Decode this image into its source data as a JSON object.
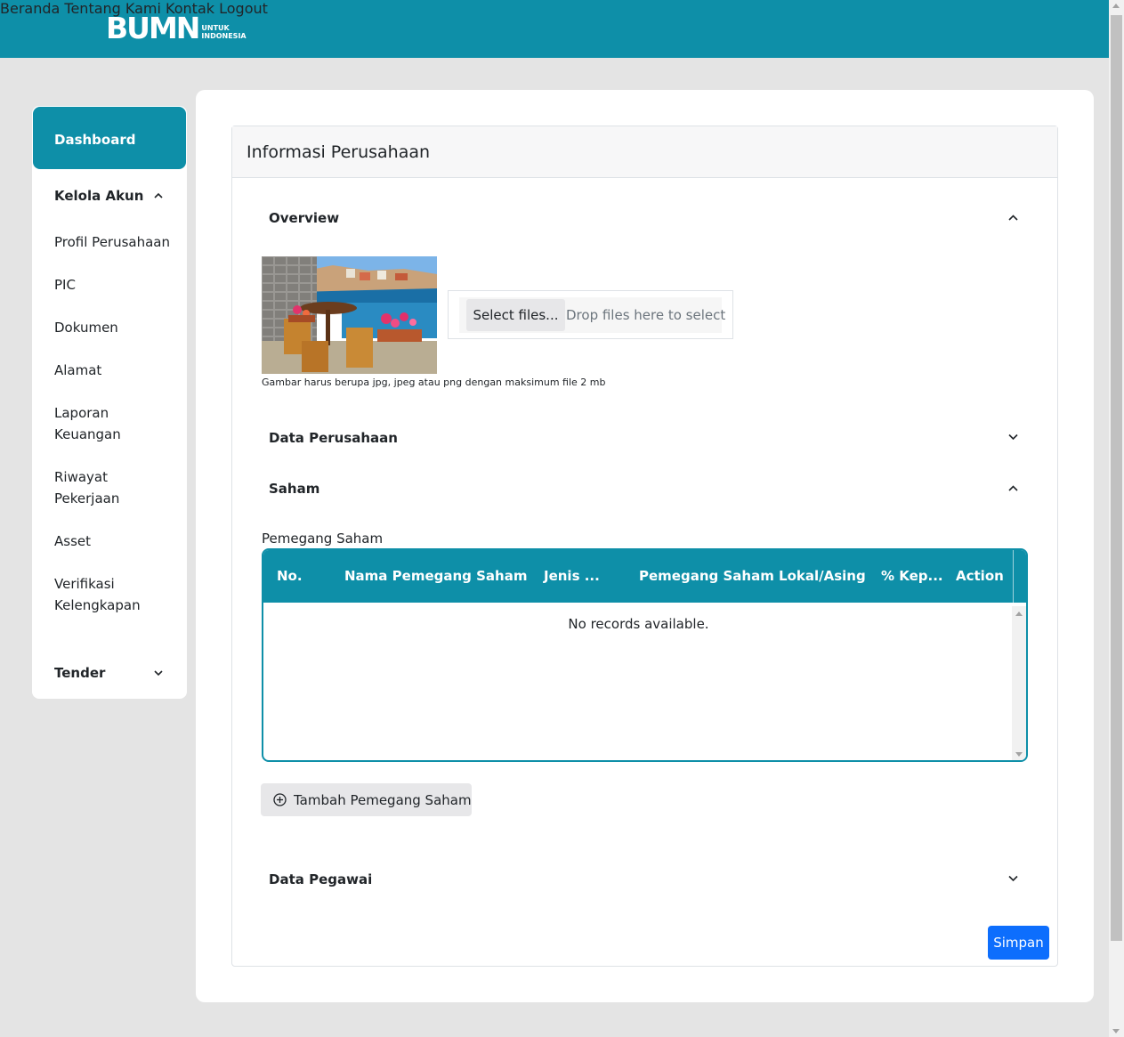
{
  "header": {
    "logo_text": "BUMN",
    "logo_sub_1": "UNTUK",
    "logo_sub_2": "INDONESIA",
    "nav": [
      "Beranda",
      "Tentang Kami",
      "Kontak",
      "Logout"
    ]
  },
  "sidebar": {
    "dashboard": "Dashboard",
    "kelola_akun": "Kelola Akun",
    "items": [
      "Profil Perusahaan",
      "PIC",
      "Dokumen",
      "Alamat",
      "Laporan Keuangan",
      "Riwayat Pekerjaan",
      "Asset",
      "Verifikasi Kelengkapan"
    ],
    "tender": "Tender"
  },
  "main": {
    "title": "Informasi Perusahaan",
    "sections": {
      "overview": "Overview",
      "data_perusahaan": "Data Perusahaan",
      "saham": "Saham",
      "data_pegawai": "Data Pegawai"
    },
    "upload": {
      "select_label": "Select files...",
      "drop_hint": "Drop files here to select",
      "note": "Gambar harus berupa jpg, jpeg atau png dengan maksimum file 2 mb"
    },
    "grid": {
      "label": "Pemegang Saham",
      "columns": [
        "No.",
        "Nama Pemegang Saham",
        "Jenis ...",
        "Pemegang Saham Lokal/Asing",
        "% Kep...",
        "Action"
      ],
      "empty": "No records available."
    },
    "add_button": "Tambah Pemegang Saham",
    "save_button": "Simpan"
  },
  "colors": {
    "brand": "#0e8fa8",
    "primary": "#0d6efd"
  }
}
